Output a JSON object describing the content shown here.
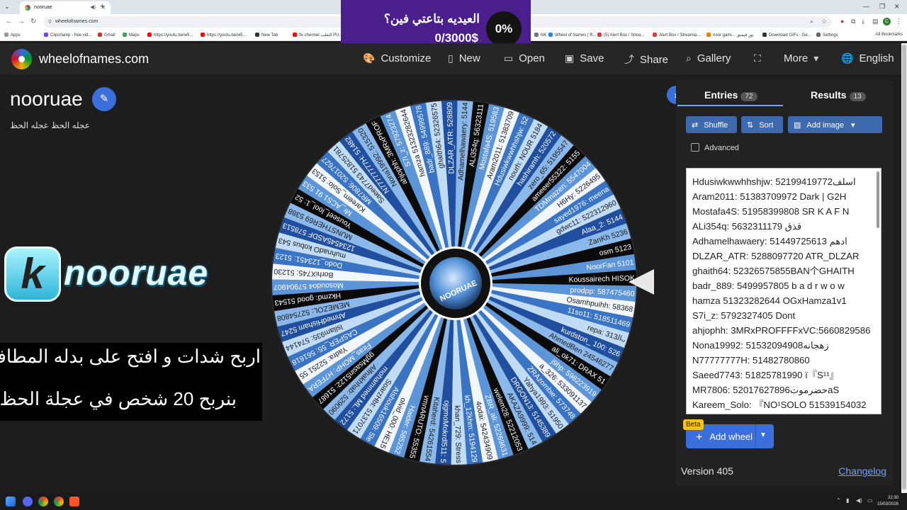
{
  "browser": {
    "tab_title": "nooruae",
    "url": "wheelofnames.com",
    "bookmarks": [
      {
        "label": "Apps",
        "color": "#999999"
      },
      {
        "label": "Clipchamp - free vid...",
        "color": "#7b3ff2"
      },
      {
        "label": "Gmail",
        "color": "#d93025"
      },
      {
        "label": "Maps",
        "color": "#34a853"
      },
      {
        "label": "https://youtu.be/w5...",
        "color": "#ff0000"
      },
      {
        "label": "https://youtu.be/w5...",
        "color": "#ff0000"
      },
      {
        "label": "New Tab",
        "color": "#333333"
      },
      {
        "label": "fix chennel التغلب PU...",
        "color": "#ff0000"
      },
      {
        "label": "NK",
        "color": "#777777"
      },
      {
        "label": "Wheel of Names | R...",
        "color": "#1e88e5"
      },
      {
        "label": "(5) Alert Box / Strea...",
        "color": "#e53935"
      },
      {
        "label": "Alert Box / Streamla...",
        "color": "#e53935"
      },
      {
        "label": "noor gami... نور قيمنق",
        "color": "#f57c00"
      },
      {
        "label": "Download GIFs - Ge...",
        "color": "#333333"
      },
      {
        "label": "Settings",
        "color": "#666666"
      }
    ],
    "all_bookmarks": "All Bookmarks"
  },
  "overlay": {
    "text": "العيديه بتاعتي فين؟",
    "amount": "0/3000$",
    "percent": "0%"
  },
  "appbar": {
    "site": "wheelofnames.com",
    "menu": [
      {
        "label": "Customize",
        "icon": "palette-icon",
        "glyph": "🎨"
      },
      {
        "label": "New",
        "icon": "file-icon",
        "glyph": "▯"
      },
      {
        "label": "Open",
        "icon": "folder-icon",
        "glyph": "▭"
      },
      {
        "label": "Save",
        "icon": "save-icon",
        "glyph": "▣"
      },
      {
        "label": "Share",
        "icon": "share-icon",
        "glyph": "⤴"
      },
      {
        "label": "Gallery",
        "icon": "search-icon",
        "glyph": "⌕"
      },
      {
        "label": "",
        "icon": "fullscreen-icon",
        "glyph": "⛶"
      },
      {
        "label": "More",
        "icon": "chevron-down-icon",
        "glyph": "▾"
      },
      {
        "label": "English",
        "icon": "globe-icon",
        "glyph": "🌐"
      }
    ]
  },
  "wheel": {
    "title": "nooruae",
    "description": "عجله الحظ عجله الحظ",
    "banner_text": "nooruae",
    "banner_letter": "k",
    "promo_line1": "اربح شدات و افتح على بدله المطافي",
    "promo_line2": "بنربح 20 شخص في عجلة الحظ",
    "center_label": "NOORUAE",
    "segment_labels": [
      "Koussairech HISOK",
      "prodpp: 587475460",
      "Osamhpuihh: 58368",
      "11so11: 518511469",
      "repa: اﻟ313ᴗ",
      "kurdston_ 100: 526",
      "AhmedBen 24546277",
      "ali_ok71: DRAX 51",
      "j9hp: 598223919",
      "a_326: 533091137",
      "ZRAzombie: 573748",
      "Yahya1993: 51950",
      "DRGON13: 5145389",
      "AKAZA9999: 514",
      "welem28: 52212053",
      "ZBR_ali: 52269631",
      "4odai: 542434909",
      "kh_12khm: 5194129",
      "khan_729: Stress",
      "ojgmoMokrdl511: 5",
      "Kitaherd: 54261554",
      "vmnARUTO: 55355",
      "Haider: 585252",
      "olvid_000: HE15",
      "Alshouk16509: 5le",
      "SoarzHbt: 5137071",
      "mohammed ML: 5172",
      "Alfnakhhab: 529090",
      "ggMsasin5122: 51687",
      "Firas_MOHP: H7FERA",
      "Yadra: 52251 55",
      "CASPER_55: 561618",
      "lsllam935: 574144",
      "AhmedHisham 5247",
      "MEMEZOL: 52754808",
      "Hkzmd: good 51543",
      "Mosoudo4 57904907",
      "BorhiX745: 51230",
      "Dodo_123451: 5123",
      "muhnadO kobus 543",
      "1234545ASDF 578513",
      "MUNSTHER69 5388",
      "Youseef_lool_1: 52",
      "Mr_ACS1 91 533",
      "Kareem_Solo: 5153",
      "MR7806: 52017627",
      "Saeed7743 51825781",
      "N77777777H: 51482",
      "Nona19992: 515320",
      "ahjophh: 3MRxPROF",
      "S7i_z: 57923274",
      "hamza 51323282644",
      "badr_889: 54999578",
      "ghaith64: 52326575",
      "DLZAR_ATR: 528809",
      "Adhamelhawaery: 5144",
      "ALi354q: 56323111",
      "Mostafa4S: 519583",
      "Aram2011: 51383709",
      "Hdusiwkwwhhshjw: 52",
      "nourh: NOUR 5184",
      "hashiramh: 520572",
      "zero_65: 5195547",
      "ameeer55322: 5155",
      "TDMmazen: 5547004",
      "H6Hy: 5226495",
      "sayed1976: meena",
      "gdwc11: 522312960",
      "Alaa_2: 5144",
      "ZanKh 5236",
      "osm 5123",
      "NoorFan 5101"
    ]
  },
  "sidebar": {
    "tabs": [
      {
        "label": "Entries",
        "count": "72"
      },
      {
        "label": "Results",
        "count": "13"
      }
    ],
    "buttons": {
      "shuffle": "Shuffle",
      "sort": "Sort",
      "add_image": "Add image"
    },
    "advanced_label": "Advanced",
    "entries": [
      "Hdusiwkwwhhshjw: 52199419772اسلف",
      "Aram2011: 51383709972 Dark | G2H",
      "Mostafa4S: 51958399808 SR K A F N",
      "ALi354q: 5632311179 قذق",
      "Adhamelhawaery: 51449725613 ادهم",
      "DLZAR_ATR: 5288097720 ATR_DLZAR",
      "ghaith64: 52326575855BAN个GHAITH",
      "badr_889: 5499957805 b a d r w o w",
      "hamza 51323282644 OGxHamza1v1",
      "S7i_z: 5792327405 Dont",
      "ahjophh: 3MRxPROFFFFxVC:5660829586",
      "Nona19992: 51532094908زهجانه",
      "N77777777H: 51482780860",
      "Saeed7743: 51825781990 ï『S¹¹』",
      "MR7806: 52017627896حضرموتaS",
      "Kareem_Solo: 『NO¹SOLO 51539154032"
    ],
    "beta_label": "Beta",
    "add_wheel_label": "Add wheel",
    "version": "Version 405",
    "changelog": "Changelog"
  },
  "taskbar": {
    "time": "22:30",
    "date": "15/03/2026"
  },
  "colors": {
    "accent": "#3a6fdc",
    "wheel_palette": [
      "#0a0a0a",
      "#1f4f9e",
      "#3a74c4",
      "#5d96d8",
      "#8ab8ea",
      "#c1dcf6",
      "#f2f7fd"
    ]
  }
}
